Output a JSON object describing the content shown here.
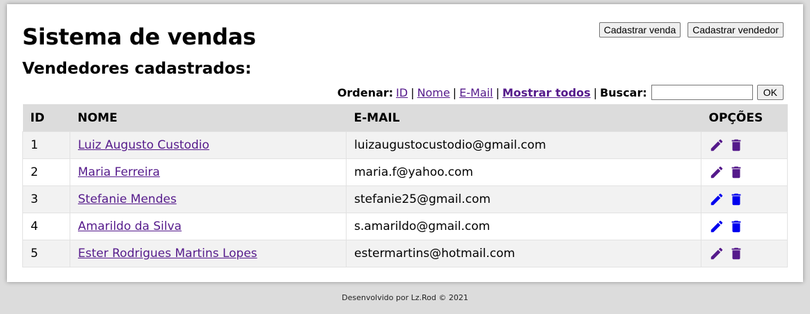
{
  "header": {
    "title": "Sistema de vendas",
    "subtitle": "Vendedores cadastrados:",
    "buttons": {
      "register_sale": "Cadastrar venda",
      "register_seller": "Cadastrar vendedor"
    }
  },
  "controls": {
    "sort_label": "Ordenar:",
    "sort_id": "ID",
    "sort_name": "Nome",
    "sort_email": "E-Mail",
    "show_all": "Mostrar todos",
    "search_label": "Buscar:",
    "search_value": "",
    "ok_label": "OK",
    "separator": "|"
  },
  "table": {
    "headers": [
      "ID",
      "NOME",
      "E-MAIL",
      "OPÇÕES"
    ],
    "rows": [
      {
        "id": "1",
        "name": "Luiz Augusto Custodio",
        "email": "luizaugustocustodio@gmail.com",
        "icon_color": "#551a8b"
      },
      {
        "id": "2",
        "name": "Maria Ferreira",
        "email": "maria.f@yahoo.com",
        "icon_color": "#551a8b"
      },
      {
        "id": "3",
        "name": "Stefanie Mendes",
        "email": "stefanie25@gmail.com",
        "icon_color": "#0000ee"
      },
      {
        "id": "4",
        "name": "Amarildo da Silva",
        "email": "s.amarildo@gmail.com",
        "icon_color": "#0000ee"
      },
      {
        "id": "5",
        "name": "Ester Rodrigues Martins Lopes",
        "email": "estermartins@hotmail.com",
        "icon_color": "#551a8b"
      }
    ],
    "edit_icon": "pencil-icon",
    "delete_icon": "trash-icon"
  },
  "footer": {
    "text": "Desenvolvido por Lz.Rod © 2021"
  },
  "colors": {
    "link_visited": "#551a8b",
    "link": "#0000ee",
    "header_bg": "#dcdcdc",
    "stripe_bg": "#f2f2f2"
  }
}
